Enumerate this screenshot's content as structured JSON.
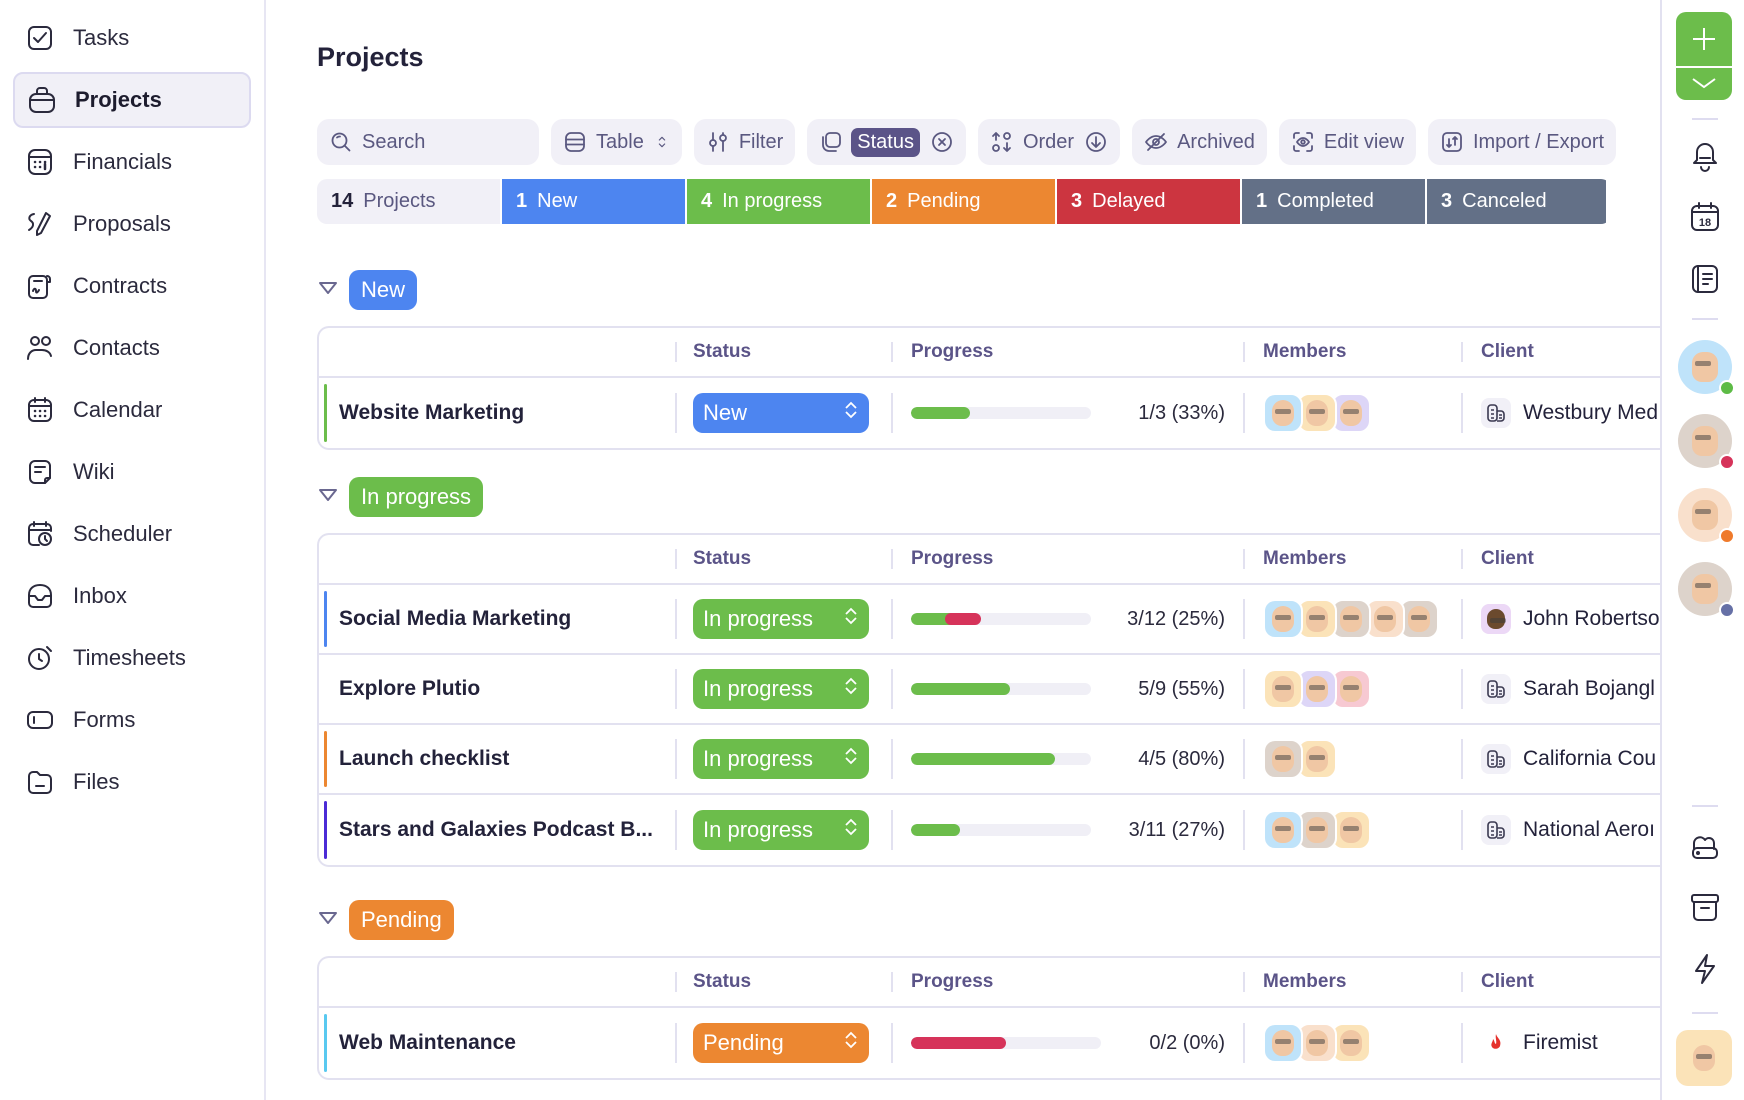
{
  "sidebar": {
    "items": [
      {
        "label": "Tasks",
        "icon": "check-square-icon",
        "active": false
      },
      {
        "label": "Projects",
        "icon": "briefcase-icon",
        "active": true
      },
      {
        "label": "Financials",
        "icon": "calculator-icon",
        "active": false
      },
      {
        "label": "Proposals",
        "icon": "pen-icon",
        "active": false
      },
      {
        "label": "Contracts",
        "icon": "contract-icon",
        "active": false
      },
      {
        "label": "Contacts",
        "icon": "people-icon",
        "active": false
      },
      {
        "label": "Calendar",
        "icon": "calendar-icon",
        "active": false
      },
      {
        "label": "Wiki",
        "icon": "note-icon",
        "active": false
      },
      {
        "label": "Scheduler",
        "icon": "calendar-clock-icon",
        "active": false
      },
      {
        "label": "Inbox",
        "icon": "inbox-icon",
        "active": false
      },
      {
        "label": "Timesheets",
        "icon": "clock-icon",
        "active": false
      },
      {
        "label": "Forms",
        "icon": "form-icon",
        "active": false
      },
      {
        "label": "Files",
        "icon": "folder-icon",
        "active": false
      }
    ]
  },
  "page": {
    "title": "Projects"
  },
  "toolbar": {
    "search_placeholder": "Search",
    "view_label": "Table",
    "filter_label": "Filter",
    "group_chip": "Status",
    "order_label": "Order",
    "archived_label": "Archived",
    "edit_view_label": "Edit view",
    "import_export_label": "Import / Export"
  },
  "summary": {
    "total": {
      "count": "14",
      "label": "Projects"
    },
    "statuses": [
      {
        "count": "1",
        "label": "New",
        "color": "#4d85f0"
      },
      {
        "count": "4",
        "label": "In progress",
        "color": "#6cbd4b"
      },
      {
        "count": "2",
        "label": "Pending",
        "color": "#ec8731"
      },
      {
        "count": "3",
        "label": "Delayed",
        "color": "#cc3540"
      },
      {
        "count": "1",
        "label": "Completed",
        "color": "#637087"
      },
      {
        "count": "3",
        "label": "Canceled",
        "color": "#637087"
      }
    ]
  },
  "columns": {
    "status": "Status",
    "progress": "Progress",
    "members": "Members",
    "client": "Client"
  },
  "groups": [
    {
      "label": "New",
      "color": "#4d85f0",
      "rows": [
        {
          "name": "Website Marketing",
          "accent": "#6cbd4b",
          "status": "New",
          "status_color": "#4d85f0",
          "progress": {
            "done": 1,
            "total": 3,
            "percent": 33,
            "text": "1/3 (33%)",
            "overdue_percent": 0
          },
          "members": [
            "#bfe3fa",
            "#fbe3b8",
            "#ddd6f7"
          ],
          "client": "Westbury Med",
          "client_icon": "building-icon"
        }
      ]
    },
    {
      "label": "In progress",
      "color": "#6cbd4b",
      "rows": [
        {
          "name": "Social Media Marketing",
          "accent": "#4d85f0",
          "status": "In progress",
          "status_color": "#6cbd4b",
          "progress": {
            "done": 3,
            "total": 12,
            "percent": 25,
            "text": "3/12 (25%)",
            "overdue_percent": 20
          },
          "members": [
            "#bfe3fa",
            "#fbe3b8",
            "#ddd3cb",
            "#f9e0cc",
            "#ddd3cb"
          ],
          "client": "John Robertso",
          "client_icon": "person-avatar-icon"
        },
        {
          "name": "Explore Plutio",
          "accent": "",
          "status": "In progress",
          "status_color": "#6cbd4b",
          "progress": {
            "done": 5,
            "total": 9,
            "percent": 55,
            "text": "5/9 (55%)",
            "overdue_percent": 0
          },
          "members": [
            "#fbe3b8",
            "#ddd6f7",
            "#f7c9d2"
          ],
          "client": "Sarah Bojangl",
          "client_icon": "building-icon"
        },
        {
          "name": "Launch checklist",
          "accent": "#ec8731",
          "status": "In progress",
          "status_color": "#6cbd4b",
          "progress": {
            "done": 4,
            "total": 5,
            "percent": 80,
            "text": "4/5 (80%)",
            "overdue_percent": 0
          },
          "members": [
            "#ddd3cb",
            "#fbe3b8"
          ],
          "client": "California Cou",
          "client_icon": "building-icon"
        },
        {
          "name": "Stars and Galaxies Podcast B...",
          "accent": "#4b2bd6",
          "status": "In progress",
          "status_color": "#6cbd4b",
          "progress": {
            "done": 3,
            "total": 11,
            "percent": 27,
            "text": "3/11 (27%)",
            "overdue_percent": 0
          },
          "members": [
            "#bfe3fa",
            "#ddd3cb",
            "#fbe3b8"
          ],
          "client": "National Aeroı",
          "client_icon": "building-icon"
        }
      ]
    },
    {
      "label": "Pending",
      "color": "#ec8731",
      "rows": [
        {
          "name": "Web Maintenance",
          "accent": "#59c9f0",
          "status": "Pending",
          "status_color": "#ec8731",
          "progress": {
            "done": 0,
            "total": 2,
            "percent": 0,
            "text": "0/2 (0%)",
            "overdue_percent": 50
          },
          "members": [
            "#bfe3fa",
            "#f9e0cc",
            "#fbe3b8"
          ],
          "client": "Firemist",
          "client_icon": "flame-logo-icon"
        }
      ]
    }
  ],
  "rail": {
    "icons": [
      "bell-icon",
      "calendar-18-icon",
      "notes-icon"
    ],
    "calendar_day": "18",
    "users": [
      {
        "bg": "#bfe3fa",
        "presence": "online",
        "presence_color": "#5dbb46"
      },
      {
        "bg": "#ddd3cb",
        "presence": "busy",
        "presence_color": "#d6335a"
      },
      {
        "bg": "#f9e0cc",
        "presence": "away",
        "presence_color": "#ef7a2b"
      },
      {
        "bg": "#ddd3cb",
        "presence": "offline",
        "presence_color": "#6670a6"
      }
    ],
    "bottom_icons": [
      "cloud-drive-icon",
      "archive-icon",
      "lightning-icon"
    ]
  }
}
